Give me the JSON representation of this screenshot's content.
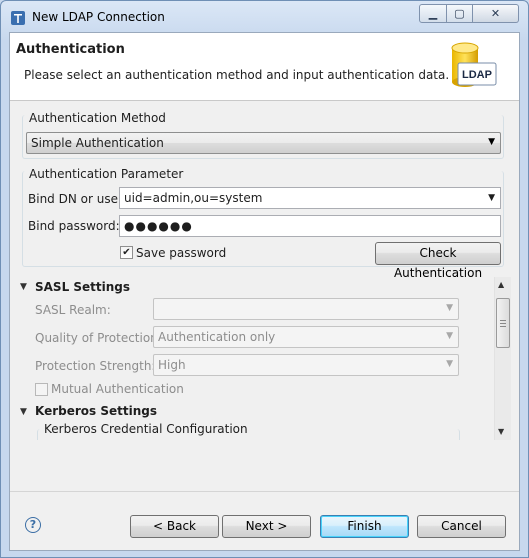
{
  "window": {
    "title": "New LDAP Connection"
  },
  "header": {
    "title": "Authentication",
    "description": "Please select an authentication method and input authentication data.",
    "logo_text": "LDAP"
  },
  "auth_method": {
    "group_label": "Authentication Method",
    "selected": "Simple Authentication"
  },
  "auth_param": {
    "group_label": "Authentication Parameter",
    "bind_dn_label": "Bind DN or user:",
    "bind_dn_value": "uid=admin,ou=system",
    "bind_password_label": "Bind password:",
    "bind_password_value": "●●●●●●",
    "save_password_label": "Save password",
    "save_password_checked": true,
    "check_button": "Check Authentication"
  },
  "sasl": {
    "title": "SASL Settings",
    "realm_label": "SASL Realm:",
    "realm_value": "",
    "qop_label": "Quality of Protection:",
    "qop_value": "Authentication only",
    "strength_label": "Protection Strength:",
    "strength_value": "High",
    "mutual_label": "Mutual Authentication",
    "mutual_checked": false
  },
  "kerberos": {
    "title": "Kerberos Settings",
    "credential_label": "Kerberos Credential Configuration"
  },
  "footer": {
    "help_symbol": "?",
    "back_label": "< Back",
    "next_label": "Next >",
    "finish_label": "Finish",
    "cancel_label": "Cancel"
  }
}
